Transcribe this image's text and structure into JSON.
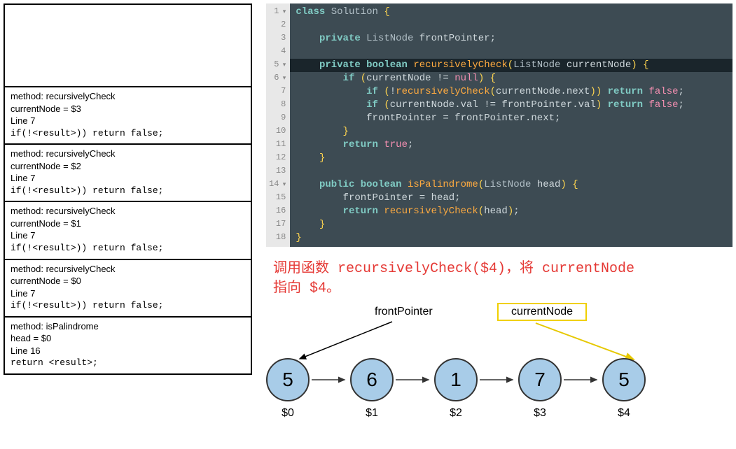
{
  "stack": {
    "frames": [
      {
        "method": "method: recursivelyCheck",
        "var": "currentNode = $3",
        "line": "Line 7",
        "code": "if(!<result>)) return false;"
      },
      {
        "method": "method: recursivelyCheck",
        "var": "currentNode = $2",
        "line": "Line 7",
        "code": "if(!<result>)) return false;"
      },
      {
        "method": "method: recursivelyCheck",
        "var": "currentNode = $1",
        "line": "Line 7",
        "code": "if(!<result>)) return false;"
      },
      {
        "method": "method: recursivelyCheck",
        "var": "currentNode = $0",
        "line": "Line 7",
        "code": "if(!<result>)) return false;"
      },
      {
        "method": "method: isPalindrome",
        "var": "head = $0",
        "line": "Line 16",
        "code": "return <result>;"
      }
    ]
  },
  "code": {
    "lines": [
      "class Solution {",
      "",
      "    private ListNode frontPointer;",
      "",
      "    private boolean recursivelyCheck(ListNode currentNode) {",
      "        if (currentNode != null) {",
      "            if (!recursivelyCheck(currentNode.next)) return false;",
      "            if (currentNode.val != frontPointer.val) return false;",
      "            frontPointer = frontPointer.next;",
      "        }",
      "        return true;",
      "    }",
      "",
      "    public boolean isPalindrome(ListNode head) {",
      "        frontPointer = head;",
      "        return recursivelyCheck(head);",
      "    }",
      "}"
    ],
    "highlight": 5
  },
  "annotation": {
    "text1": "调用函数 recursivelyCheck($4)，将 currentNode",
    "text2": "指向 $4。"
  },
  "diagram": {
    "frontPointerLabel": "frontPointer",
    "currentNodeLabel": "currentNode",
    "nodes": [
      {
        "value": "5",
        "id": "$0"
      },
      {
        "value": "6",
        "id": "$1"
      },
      {
        "value": "1",
        "id": "$2"
      },
      {
        "value": "7",
        "id": "$3"
      },
      {
        "value": "5",
        "id": "$4"
      }
    ]
  }
}
